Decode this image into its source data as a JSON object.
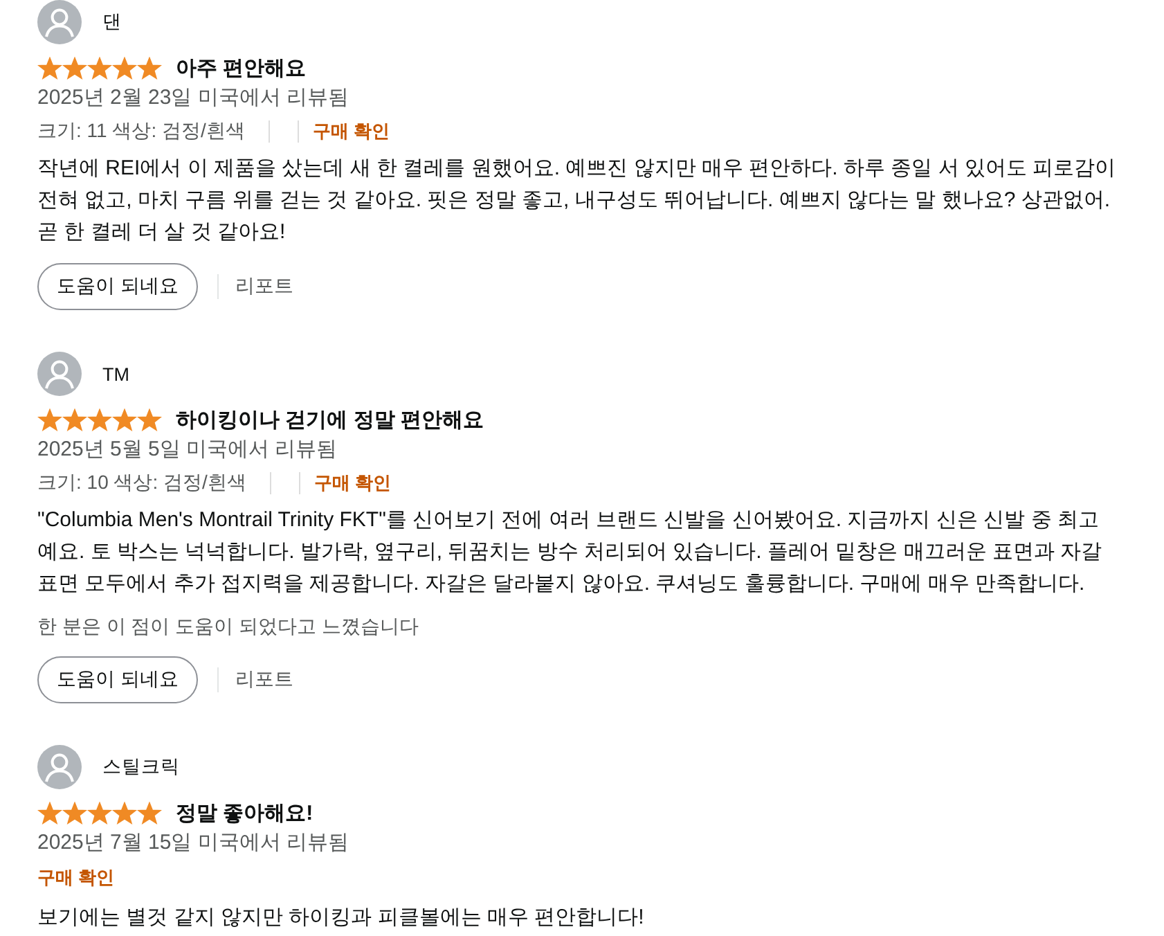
{
  "reviews": [
    {
      "author": "댄",
      "stars": 5,
      "title": "아주 편안해요",
      "date": "2025년 2월 23일 미국에서 리뷰됨",
      "variant": "크기: 11 색상: 검정/흰색",
      "verified": "구매 확인",
      "body": "작년에 REI에서 이 제품을 샀는데 새 한 켤레를 원했어요. 예쁘진 않지만 매우 편안하다. 하루 종일 서 있어도 피로감이 전혀 없고, 마치 구름 위를 걷는 것 같아요. 핏은 정말 좋고, 내구성도 뛰어납니다. 예쁘지 않다는 말 했나요? 상관없어. 곧 한 켤레 더 살 것 같아요!",
      "actions": {
        "helpful": "도움이 되네요",
        "report": "리포트"
      }
    },
    {
      "author": "TM",
      "stars": 5,
      "title": "하이킹이나 걷기에 정말 편안해요",
      "date": "2025년 5월 5일 미국에서 리뷰됨",
      "variant": "크기: 10 색상: 검정/흰색",
      "verified": "구매 확인",
      "body": "\"Columbia Men's Montrail Trinity FKT\"를 신어보기 전에 여러 브랜드 신발을 신어봤어요. 지금까지 신은 신발 중 최고예요. 토 박스는 넉넉합니다. 발가락, 옆구리, 뒤꿈치는 방수 처리되어 있습니다. 플레어 밑창은 매끄러운 표면과 자갈 표면 모두에서 추가 접지력을 제공합니다. 자갈은 달라붙지 않아요. 쿠셔닝도 훌륭합니다. 구매에 매우 만족합니다.",
      "helpful_count": "한 분은 이 점이 도움이 되었다고 느꼈습니다",
      "actions": {
        "helpful": "도움이 되네요",
        "report": "리포트"
      }
    },
    {
      "author": "스틸크릭",
      "stars": 5,
      "title": "정말 좋아해요!",
      "date": "2025년 7월 15일 미국에서 리뷰됨",
      "verified": "구매 확인",
      "body": "보기에는 별것 같지 않지만 하이킹과 피클볼에는 매우 편안합니다!"
    }
  ]
}
